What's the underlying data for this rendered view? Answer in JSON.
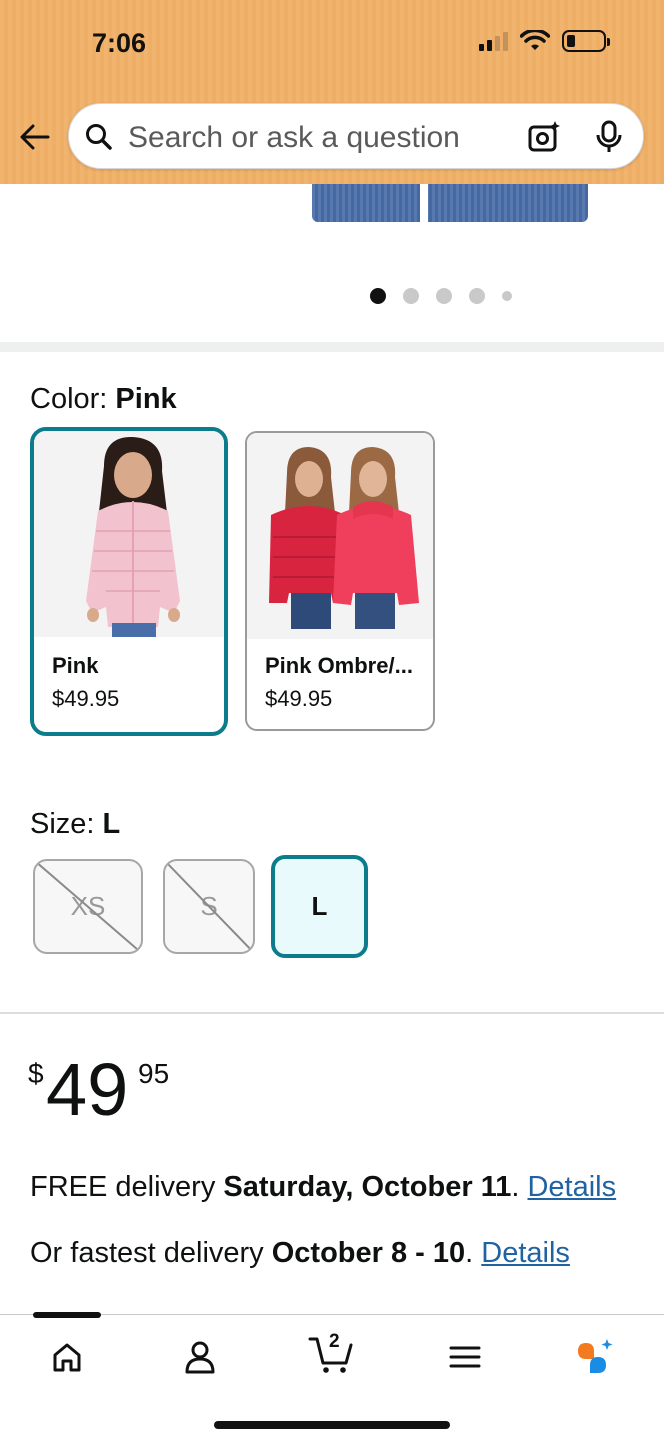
{
  "status_bar": {
    "time": "7:06"
  },
  "search": {
    "placeholder": "Search or ask a question"
  },
  "carousel": {
    "count": 5,
    "active_index": 0
  },
  "color": {
    "label": "Color: ",
    "selected": "Pink",
    "options": [
      {
        "name": "Pink",
        "price": "$49.95"
      },
      {
        "name": "Pink Ombre/...",
        "price": "$49.95"
      }
    ]
  },
  "size": {
    "label": "Size: ",
    "selected": "L",
    "options": [
      {
        "label": "XS",
        "available": false
      },
      {
        "label": "S",
        "available": false
      },
      {
        "label": "L",
        "available": true
      }
    ]
  },
  "price": {
    "currency": "$",
    "whole": "49",
    "fraction": "95"
  },
  "delivery": {
    "free_prefix": "FREE delivery ",
    "free_date": "Saturday, October 11",
    "free_suffix": ". ",
    "free_link": "Details",
    "fast_prefix": "Or fastest delivery ",
    "fast_date": "October 8 - 10",
    "fast_suffix": ". ",
    "fast_link": "Details"
  },
  "nav": {
    "cart_count": "2"
  },
  "colors": {
    "accent": "#0a7c8c",
    "link": "#2162a1",
    "header": "#f1b46f"
  },
  "icons": [
    "back-arrow-icon",
    "search-icon",
    "camera-icon",
    "microphone-icon",
    "home-icon",
    "account-icon",
    "cart-icon",
    "menu-icon",
    "rufus-icon"
  ]
}
